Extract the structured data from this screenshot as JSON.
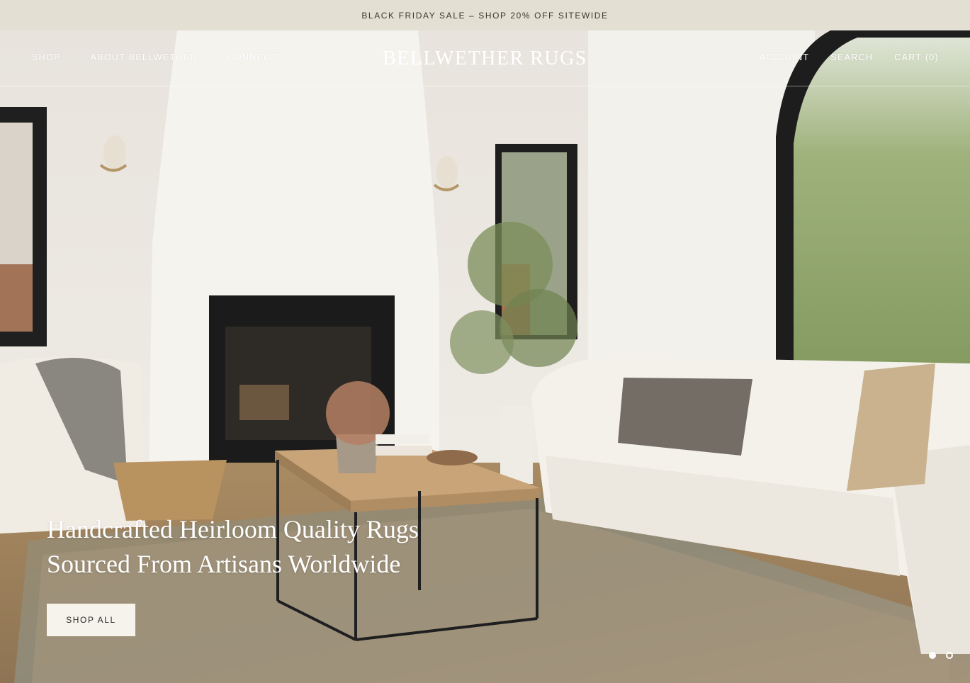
{
  "announcement": {
    "text": "BLACK FRIDAY SALE – SHOP 20% OFF SITEWIDE"
  },
  "header": {
    "logo": "BELLWETHER RUGS",
    "nav_left": [
      {
        "label": "SHOP"
      },
      {
        "label": "ABOUT BELLWETHER"
      },
      {
        "label": "CONNECT"
      }
    ],
    "nav_right": [
      {
        "label": "ACCOUNT"
      },
      {
        "label": "SEARCH"
      },
      {
        "label": "CART (0)"
      }
    ]
  },
  "hero": {
    "headline_line1": "Handcrafted Heirloom Quality Rugs",
    "headline_line2": "Sourced From Artisans Worldwide",
    "cta_label": "SHOP ALL",
    "slides": [
      {
        "active": true
      },
      {
        "active": false
      }
    ]
  },
  "colors": {
    "announcement_bg": "#e3dfd2",
    "button_bg": "#f6f3ec",
    "nav_text": "#ffffff"
  }
}
